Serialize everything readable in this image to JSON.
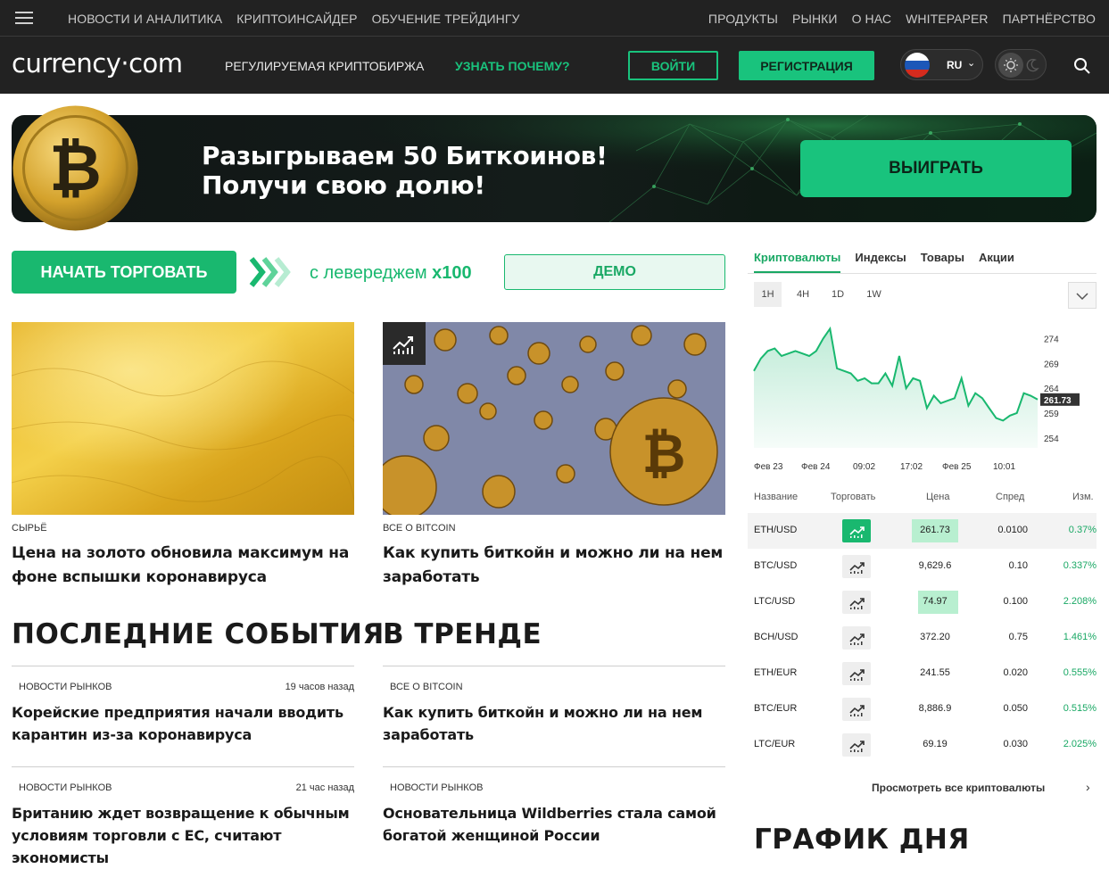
{
  "topnav": {
    "left_links": [
      "НОВОСТИ И АНАЛИТИКА",
      "КРИПТОИНСАЙДЕР",
      "ОБУЧЕНИЕ ТРЕЙДИНГУ"
    ],
    "right_links": [
      "ПРОДУКТЫ",
      "РЫНКИ",
      "О НАС",
      "WHITEPAPER",
      "ПАРТНЁРСТВО"
    ]
  },
  "header": {
    "logo": "currency·com",
    "tagline": "РЕГУЛИРУЕМАЯ КРИПТОБИРЖА",
    "why_link": "УЗНАТЬ ПОЧЕМУ?",
    "login_label": "ВОЙТИ",
    "register_label": "РЕГИСТРАЦИЯ",
    "language": "RU",
    "accent_color": "#19c37d"
  },
  "banner": {
    "title_line1": "Разыгрываем 50 Биткоинов!",
    "title_line2": "Получи свою долю!",
    "button_label": "ВЫИГРАТЬ"
  },
  "trade_row": {
    "start_label": "НАЧАТЬ ТОРГОВАТЬ",
    "leverage_text": "с левереджем ",
    "leverage_value": "x100",
    "demo_label": "ДЕМО"
  },
  "cards": [
    {
      "category": "СЫРЬЁ",
      "title": "Цена на золото обновила максимум на фоне вспышки коронавируса"
    },
    {
      "category": "ВСЕ О BITCOIN",
      "title": "Как купить биткойн и можно ли на нем заработать"
    }
  ],
  "latest": {
    "title": "ПОСЛЕДНИЕ СОБЫТИЯ",
    "items": [
      {
        "category": "НОВОСТИ РЫНКОВ",
        "time": "19 часов назад",
        "title": "Корейские предприятия начали вводить карантин из-за коронавируса"
      },
      {
        "category": "НОВОСТИ РЫНКОВ",
        "time": "21 час назад",
        "title": "Британию ждет возвращение к обычным условиям торговли с ЕС, считают экономисты"
      }
    ]
  },
  "trending": {
    "title": "В ТРЕНДЕ",
    "items": [
      {
        "category": "ВСЕ О BITCOIN",
        "title": "Как купить биткойн и можно ли на нем заработать"
      },
      {
        "category": "НОВОСТИ РЫНКОВ",
        "title": "Основательница Wildberries стала самой богатой женщиной России"
      }
    ]
  },
  "widget": {
    "tabs": [
      "Криптовалюты",
      "Индексы",
      "Товары",
      "Акции"
    ],
    "periods": [
      "1H",
      "4H",
      "1D",
      "1W"
    ],
    "columns": [
      "Название",
      "Торговать",
      "Цена",
      "Спред",
      "Изм."
    ],
    "rows": [
      {
        "name": "ETH/USD",
        "price": "261.73",
        "spread": "0.0100",
        "change": "0.37%"
      },
      {
        "name": "BTC/USD",
        "price": "9,629.6",
        "spread": "0.10",
        "change": "0.337%"
      },
      {
        "name": "LTC/USD",
        "price": "74.97",
        "spread": "0.100",
        "change": "2.208%"
      },
      {
        "name": "BCH/USD",
        "price": "372.20",
        "spread": "0.75",
        "change": "1.461%"
      },
      {
        "name": "ETH/EUR",
        "price": "241.55",
        "spread": "0.020",
        "change": "0.555%"
      },
      {
        "name": "BTC/EUR",
        "price": "8,886.9",
        "spread": "0.050",
        "change": "0.515%"
      },
      {
        "name": "LTC/EUR",
        "price": "69.19",
        "spread": "0.030",
        "change": "2.025%"
      }
    ],
    "view_all": "Просмотреть все криптовалюты",
    "graph_of_day": "ГРАФИК ДНЯ"
  },
  "chart_data": {
    "type": "area",
    "series": [
      {
        "values": [
          267.5,
          270,
          271.5,
          272,
          270.5,
          271,
          271.5,
          271,
          270.5,
          271.5,
          274,
          276,
          268,
          267.5,
          267,
          265.5,
          266,
          265,
          265,
          267,
          264.5,
          270.5,
          264,
          266,
          265.5,
          260,
          262.5,
          261,
          261.5,
          262,
          266,
          260.5,
          263,
          262,
          260,
          258,
          257.5,
          258.5,
          259,
          263,
          262.5,
          261.73
        ]
      }
    ],
    "y_ticks": [
      274,
      269,
      264,
      259,
      254
    ],
    "ylim": [
      252,
      277.5
    ],
    "x_ticks": [
      "Фев 23",
      "Фев 24",
      "09:02",
      "17:02",
      "Фев 25",
      "10:01"
    ],
    "last_value": "261.73",
    "line_color": "#19b86f"
  }
}
